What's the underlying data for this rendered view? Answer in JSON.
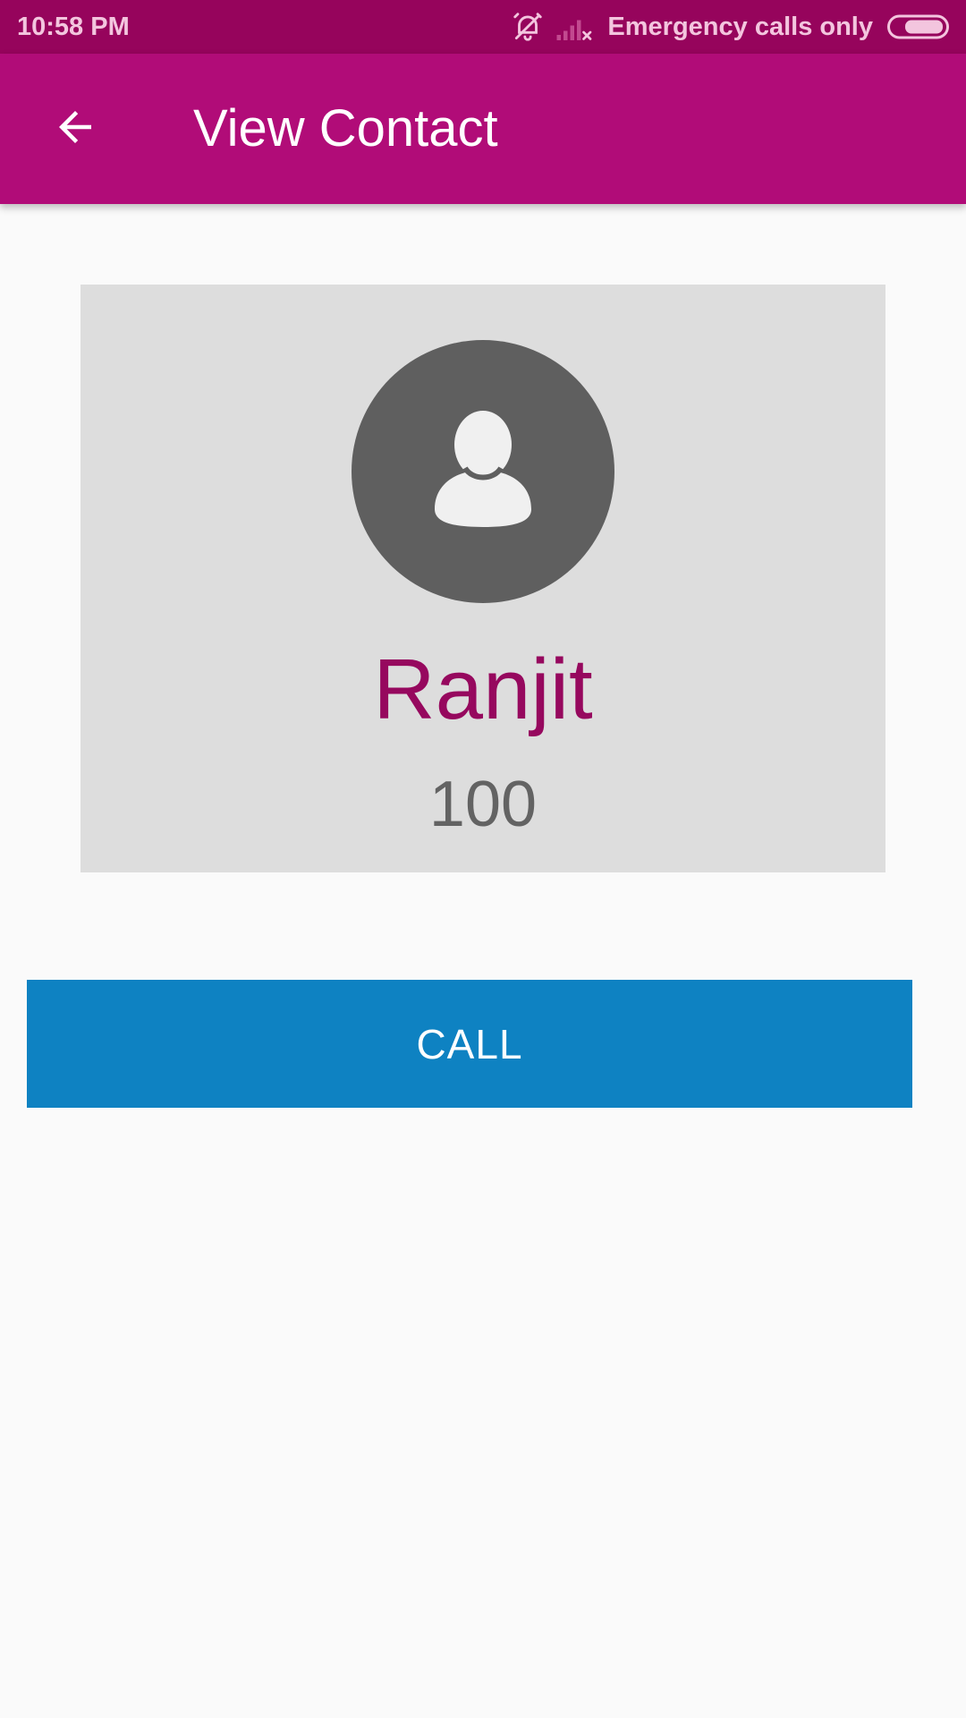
{
  "status_bar": {
    "time": "10:58 PM",
    "carrier_text": "Emergency calls only",
    "icons": [
      "alarm-off-icon",
      "no-signal-icon",
      "battery-icon"
    ]
  },
  "app_bar": {
    "title": "View Contact",
    "back_icon": "arrow-back-icon"
  },
  "contact": {
    "name": "Ranjit",
    "number": "100",
    "avatar_icon": "person-icon"
  },
  "actions": {
    "call_label": "CALL"
  },
  "colors": {
    "status_bar": "#96045c",
    "primary": "#b10c78",
    "name_text": "#96085e",
    "card_background": "#dddddd",
    "avatar_background": "#5f5f5f",
    "call_button": "#0e82c2",
    "page_background": "#fafafa"
  }
}
